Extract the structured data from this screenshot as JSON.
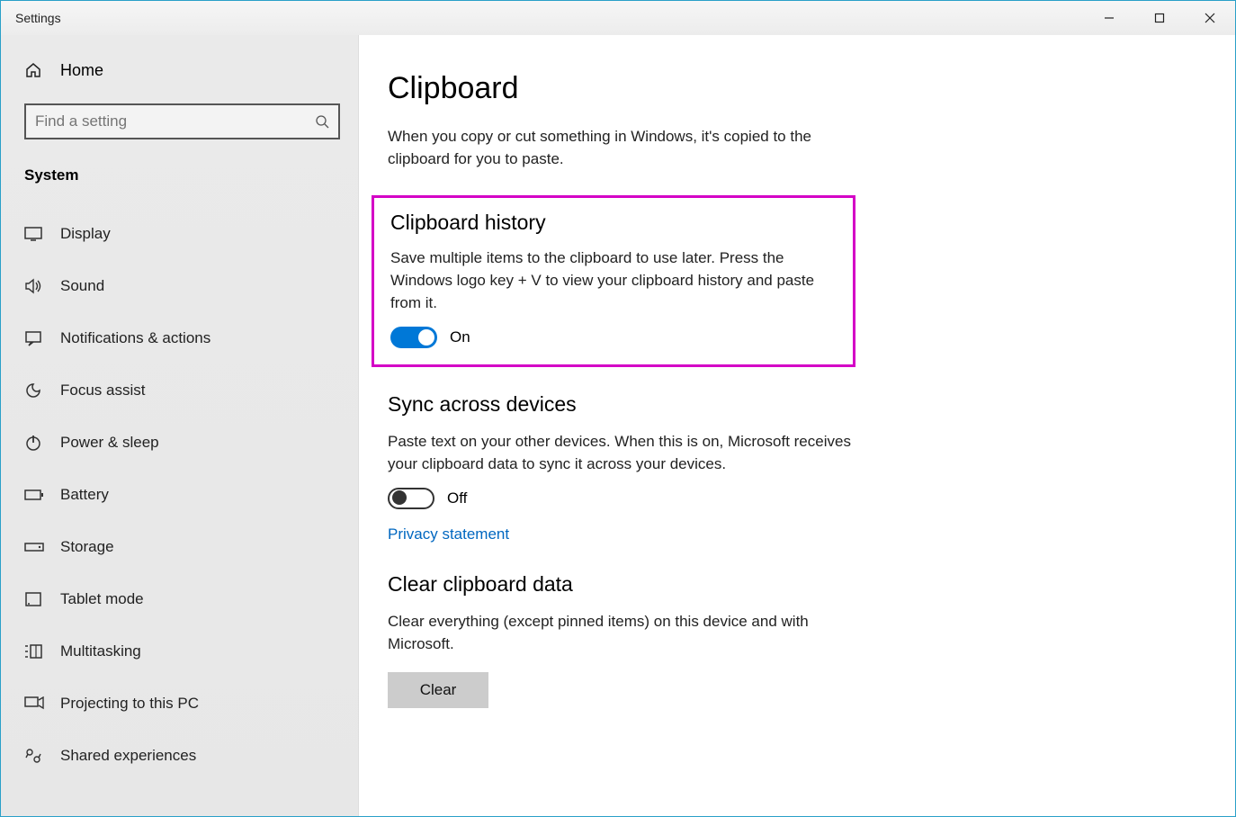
{
  "window": {
    "title": "Settings"
  },
  "sidebar": {
    "home": "Home",
    "search_placeholder": "Find a setting",
    "category": "System",
    "items": [
      {
        "label": "Display"
      },
      {
        "label": "Sound"
      },
      {
        "label": "Notifications & actions"
      },
      {
        "label": "Focus assist"
      },
      {
        "label": "Power & sleep"
      },
      {
        "label": "Battery"
      },
      {
        "label": "Storage"
      },
      {
        "label": "Tablet mode"
      },
      {
        "label": "Multitasking"
      },
      {
        "label": "Projecting to this PC"
      },
      {
        "label": "Shared experiences"
      }
    ]
  },
  "main": {
    "title": "Clipboard",
    "intro": "When you copy or cut something in Windows, it's copied to the clipboard for you to paste.",
    "history": {
      "title": "Clipboard history",
      "desc": "Save multiple items to the clipboard to use later. Press the Windows logo key + V to view your clipboard history and paste from it.",
      "state": "On"
    },
    "sync": {
      "title": "Sync across devices",
      "desc": "Paste text on your other devices. When this is on, Microsoft receives your clipboard data to sync it across your devices.",
      "state": "Off",
      "link": "Privacy statement"
    },
    "clear": {
      "title": "Clear clipboard data",
      "desc": "Clear everything (except pinned items) on this device and with Microsoft.",
      "button": "Clear"
    }
  }
}
